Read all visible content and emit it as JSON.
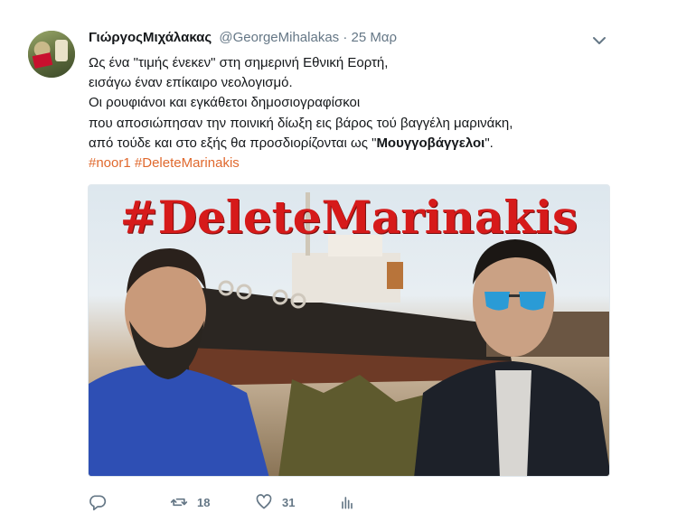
{
  "tweet": {
    "author_name": "ΓιώργοςΜιχάλακας",
    "handle": "@GeorgeMihalakas",
    "separator": "·",
    "date": "25 Μαρ",
    "lines": [
      "Ως ένα \"τιμής ένεκεν\" στη σημερινή Εθνική Εορτή,",
      "εισάγω έναν επίκαιρο νεολογισμό.",
      "Οι ρουφιάνοι και εγκάθετοι δημοσιογραφίσκοι",
      "που αποσιώπησαν την ποινική δίωξη εις βάρος τού βαγγέλη μαρινάκη,"
    ],
    "last_line_prefix": "από τούδε και στο εξής θα προσδιορίζονται ως \"",
    "last_line_bold": "Μουγγοβάγγελοι",
    "last_line_suffix": "\".",
    "hashtags": [
      "#noor1",
      "#DeleteMarinakis"
    ]
  },
  "media": {
    "overlay_text": "#DeleteMarinakis"
  },
  "actions": {
    "retweet_count": "18",
    "like_count": "31"
  },
  "colors": {
    "hashtag": "#e0692e",
    "overlay_text": "#d61a1a",
    "meta_gray": "#657786"
  }
}
